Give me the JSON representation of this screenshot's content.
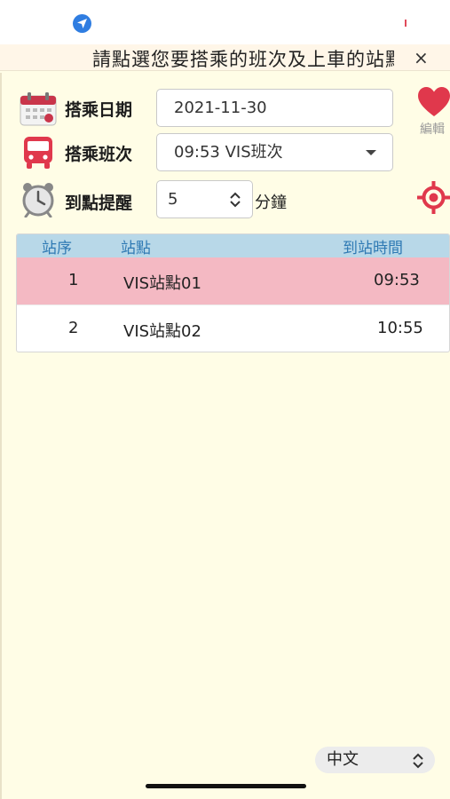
{
  "banner": {
    "text": "請點選您要搭乘的班次及上車的站點",
    "close_label": "×"
  },
  "form": {
    "date": {
      "label": "搭乘日期",
      "value": "2021-11-30",
      "icon": "calendar-icon"
    },
    "trip": {
      "label": "搭乘班次",
      "value": "09:53 VIS班次",
      "icon": "bus-icon"
    },
    "reminder": {
      "label": "到點提醒",
      "value": "5",
      "unit": "分鐘",
      "icon": "alarm-clock-icon"
    }
  },
  "favorite": {
    "label": "編輯",
    "icon": "heart-icon"
  },
  "locate": {
    "icon": "crosshair-icon"
  },
  "table": {
    "headers": {
      "seq": "站序",
      "stop": "站點",
      "arrival": "到站時間"
    },
    "rows": [
      {
        "seq": "1",
        "stop": "VIS站點01",
        "arrival": "09:53",
        "selected": true
      },
      {
        "seq": "2",
        "stop": "VIS站點02",
        "arrival": "10:55",
        "selected": false
      }
    ]
  },
  "language": {
    "value": "中文"
  },
  "colors": {
    "accent": "#e0384c",
    "background": "#fffde6",
    "selected_row": "#f4b9c3",
    "table_header": "#b8d8e8",
    "header_text": "#2f7ab4"
  }
}
